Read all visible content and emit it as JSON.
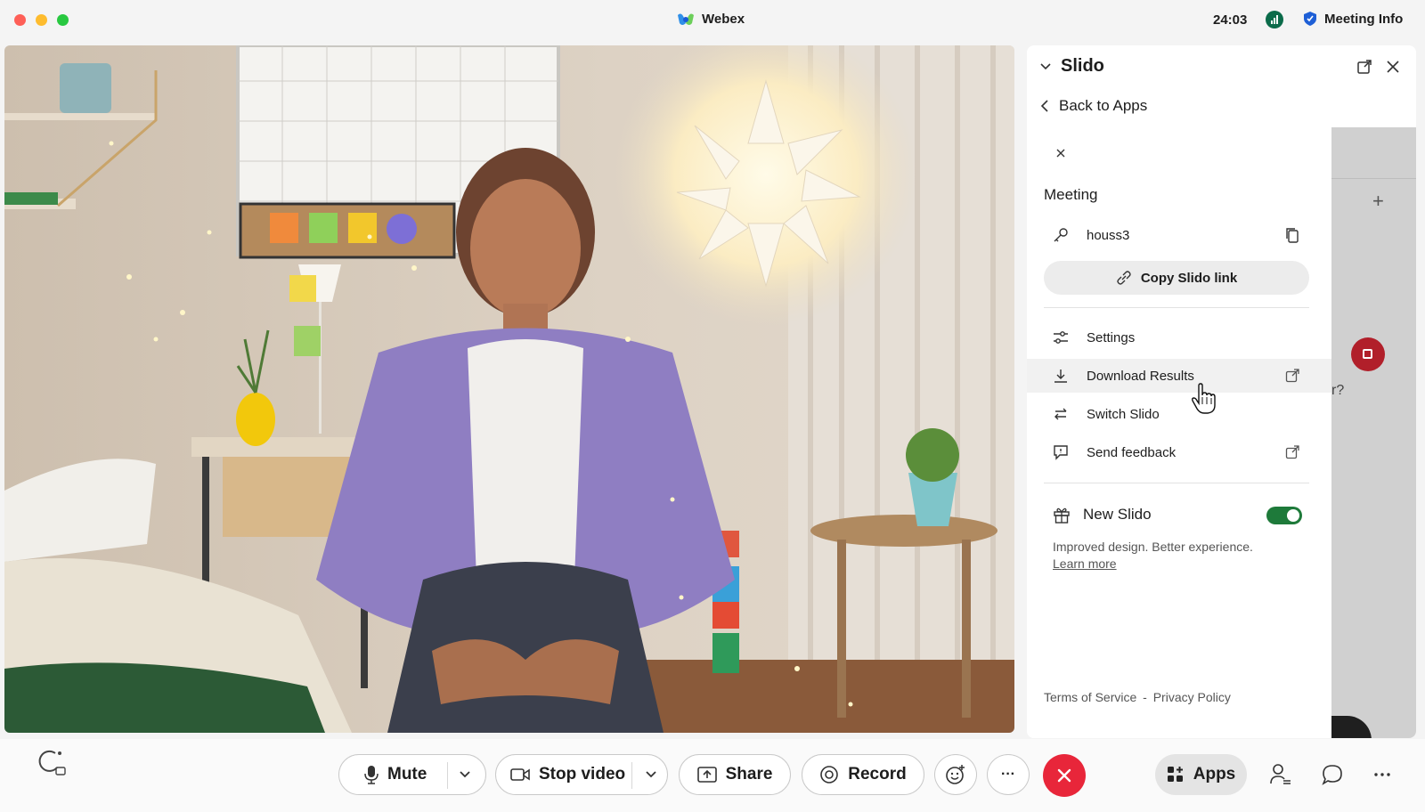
{
  "window": {
    "title": "Webex",
    "time": "24:03",
    "meeting_info_label": "Meeting Info"
  },
  "panel": {
    "title": "Slido",
    "back_label": "Back to Apps",
    "meeting_heading": "Meeting",
    "passcode": "houss3",
    "copy_link_label": "Copy Slido link",
    "menu": [
      {
        "label": "Settings",
        "icon": "sliders-icon",
        "external": false
      },
      {
        "label": "Download Results",
        "icon": "download-icon",
        "external": true
      },
      {
        "label": "Switch Slido",
        "icon": "switch-icon",
        "external": false
      },
      {
        "label": "Send feedback",
        "icon": "feedback-icon",
        "external": true
      }
    ],
    "new_slido_label": "New Slido",
    "new_slido_enabled": true,
    "new_slido_desc": "Improved design. Better experience.",
    "learn_more": "Learn more",
    "terms": "Terms of Service",
    "separator": "-",
    "privacy": "Privacy Policy",
    "background_text": "r?"
  },
  "toolbar": {
    "mute_label": "Mute",
    "stop_video_label": "Stop video",
    "share_label": "Share",
    "record_label": "Record",
    "more_label": "···",
    "apps_label": "Apps"
  },
  "colors": {
    "end_call": "#e8263a",
    "toggle_on": "#1e7a3a",
    "record_red": "#b11f2a"
  }
}
